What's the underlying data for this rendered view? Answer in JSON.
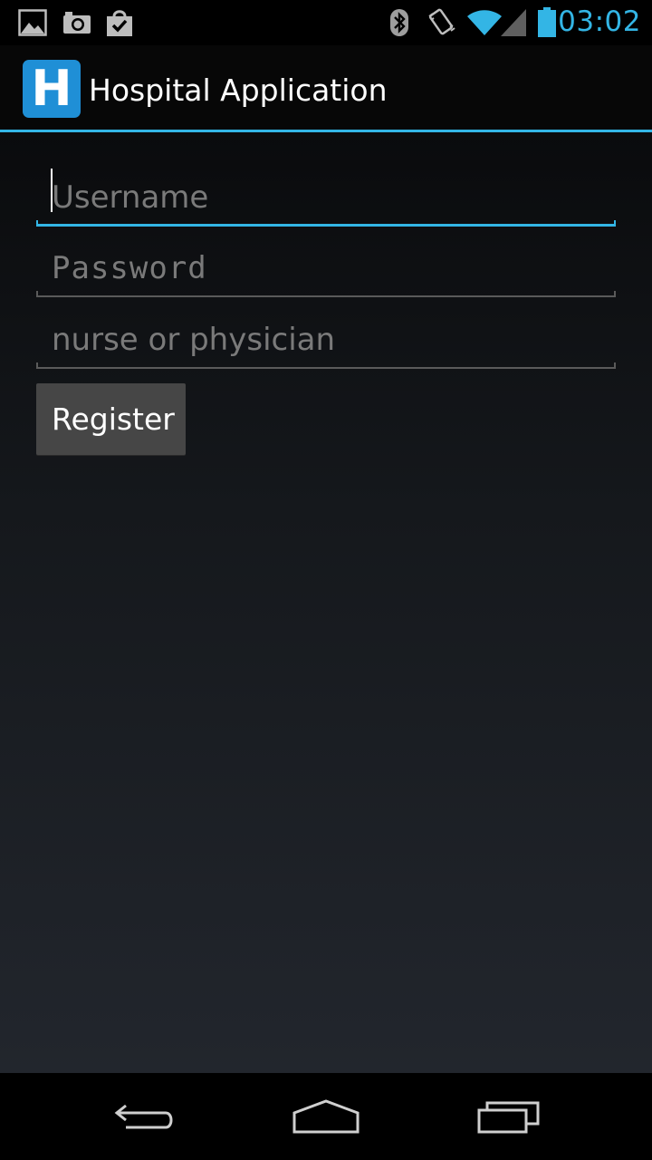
{
  "status_bar": {
    "time": "03:02",
    "icons": [
      "gallery-icon",
      "camera-icon",
      "shopping-bag-check-icon",
      "bluetooth-icon",
      "vibrate-icon",
      "wifi-icon",
      "cell-signal-icon",
      "battery-icon"
    ]
  },
  "action_bar": {
    "logo_letter": "H",
    "title": "Hospital Application"
  },
  "form": {
    "username": {
      "placeholder": "Username",
      "value": ""
    },
    "password": {
      "placeholder": "Password",
      "value": ""
    },
    "role": {
      "placeholder": "nurse or physician",
      "value": ""
    },
    "register_label": "Register"
  },
  "nav_bar": {
    "icons": [
      "back-icon",
      "home-icon",
      "recent-apps-icon"
    ]
  },
  "colors": {
    "accent": "#33b5e5",
    "logo": "#1f8fd6",
    "button": "#464646"
  }
}
